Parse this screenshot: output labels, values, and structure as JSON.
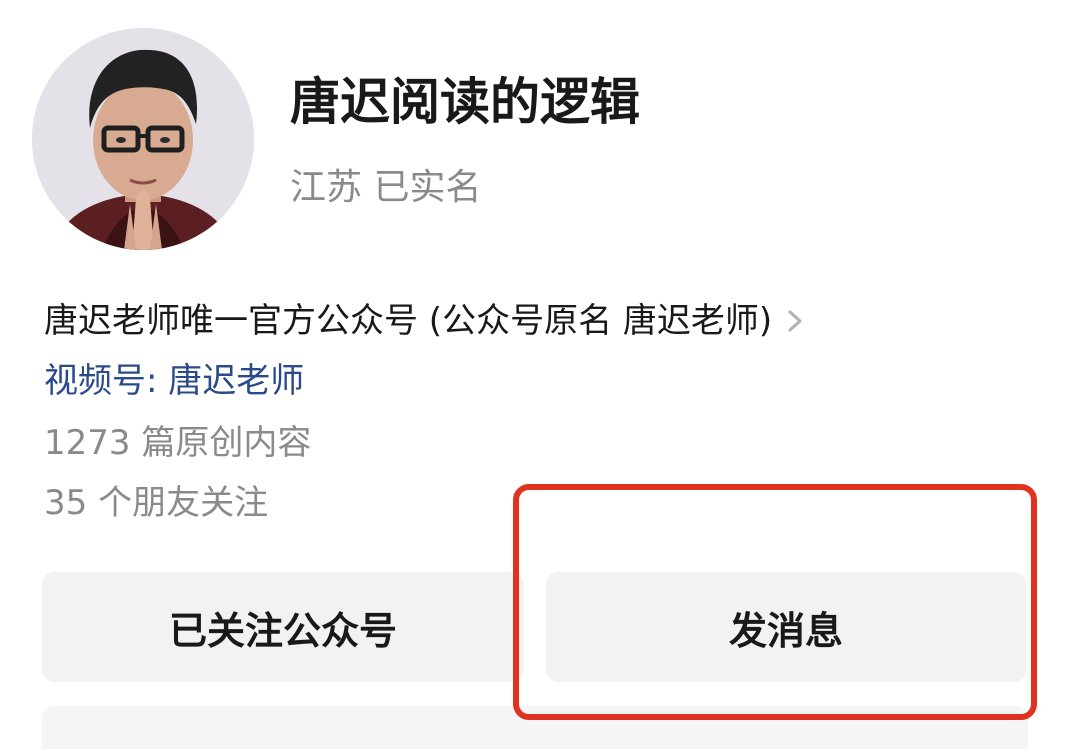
{
  "profile": {
    "name": "唐迟阅读的逻辑",
    "subtitle": "江苏 已实名",
    "description": "唐迟老师唯一官方公众号 (公众号原名 唐迟老师)",
    "channel": "视频号: 唐迟老师",
    "original_count": "1273 篇原创内容",
    "friends_following": "35 个朋友关注"
  },
  "actions": {
    "follow_label": "已关注公众号",
    "message_label": "发消息"
  },
  "colors": {
    "highlight": "#e0321f",
    "link": "#2a4a8a",
    "button_bg": "#f2f2f2",
    "muted_text": "#8a8a8a"
  },
  "icons": {
    "chevron": "chevron-right-icon",
    "avatar": "avatar"
  }
}
